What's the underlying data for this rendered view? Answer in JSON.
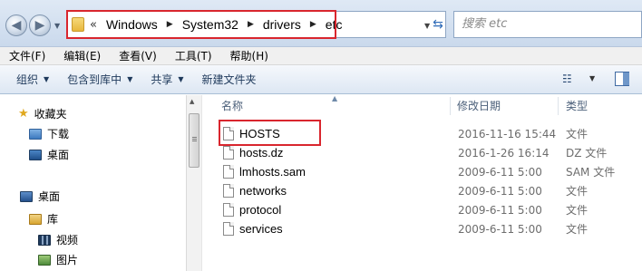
{
  "address_bar": {
    "prefix": "«",
    "crumbs": [
      "Windows",
      "System32",
      "drivers",
      "etc"
    ]
  },
  "search": {
    "placeholder": "搜索 etc"
  },
  "menu": [
    "文件(F)",
    "编辑(E)",
    "查看(V)",
    "工具(T)",
    "帮助(H)"
  ],
  "toolbar": {
    "organize": "组织",
    "include_in_library": "包含到库中",
    "share": "共享",
    "new_folder": "新建文件夹"
  },
  "nav_pane": {
    "favorites": "收藏夹",
    "downloads": "下载",
    "desktop_fav": "桌面",
    "desktop": "桌面",
    "library": "库",
    "videos": "视频",
    "pictures": "图片"
  },
  "columns": {
    "name": "名称",
    "modified": "修改日期",
    "type": "类型"
  },
  "files": [
    {
      "name": "HOSTS",
      "modified": "2016-11-16 15:44",
      "type": "文件"
    },
    {
      "name": "hosts.dz",
      "modified": "2016-1-26 16:14",
      "type": "DZ 文件"
    },
    {
      "name": "lmhosts.sam",
      "modified": "2009-6-11 5:00",
      "type": "SAM 文件"
    },
    {
      "name": "networks",
      "modified": "2009-6-11 5:00",
      "type": "文件"
    },
    {
      "name": "protocol",
      "modified": "2009-6-11 5:00",
      "type": "文件"
    },
    {
      "name": "services",
      "modified": "2009-6-11 5:00",
      "type": "文件"
    }
  ],
  "colors": {
    "annotation_red": "#d9262e",
    "link_blue": "#1e395b"
  }
}
